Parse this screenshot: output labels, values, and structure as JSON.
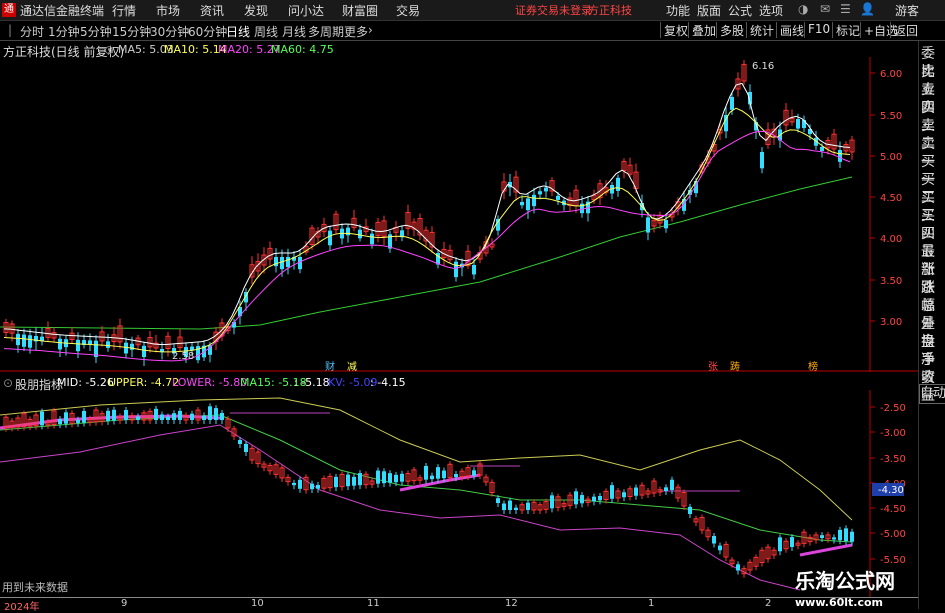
{
  "app": {
    "title": "通达信金融终端",
    "menus": [
      "行情",
      "市场",
      "资讯",
      "发现",
      "问小达",
      "财富圈",
      "交易"
    ],
    "notice": "证券交易未登录",
    "stock_name_top": "方正科技",
    "right_menus": [
      "功能",
      "版面",
      "公式",
      "选项"
    ],
    "guest": "游客"
  },
  "toolbar": {
    "periods": [
      "分时",
      "1分钟",
      "5分钟",
      "15分钟",
      "30分钟",
      "60分钟",
      "日线",
      "周线",
      "月线",
      "多周期",
      "更多"
    ],
    "active_period": "日线",
    "right_buttons": [
      "复权",
      "叠加",
      "多股",
      "统计",
      "画线",
      "F10",
      "标记",
      "+自选",
      "返回"
    ]
  },
  "main_chart": {
    "title": "方正科技(日线 前复权)",
    "ma_labels": [
      {
        "text": "MA5: 5.03",
        "color": "#ffffff"
      },
      {
        "text": "MA10: 5.14",
        "color": "#ffff55"
      },
      {
        "text": "MA20: 5.27",
        "color": "#ff44ff"
      },
      {
        "text": "MA60: 4.75",
        "color": "#55ff55"
      }
    ],
    "price_ticks": [
      "6.00",
      "5.50",
      "5.00",
      "4.50",
      "4.00",
      "3.50",
      "3.00"
    ],
    "high_label": "6.16",
    "low_label": "2.58",
    "markers": [
      "财",
      "减",
      "张",
      "踌",
      "榜"
    ]
  },
  "indicator": {
    "name": "股朋指标",
    "labels": [
      {
        "text": "MID: -5.26",
        "color": "#ffffff"
      },
      {
        "text": "UPPER: -4.72",
        "color": "#ffff55"
      },
      {
        "text": "LOWER: -5.80",
        "color": "#ff44ff"
      },
      {
        "text": "MA15: -5.18",
        "color": "#55ff55"
      },
      {
        "text": ": -5.18",
        "color": "#ffffff"
      },
      {
        "text": "KV: -5.09",
        "color": "#4444ff"
      },
      {
        "text": ": -4.15",
        "color": "#ffffff"
      }
    ],
    "ticks": [
      "-2.50",
      "-3.00",
      "-3.50",
      "-4.00",
      "-4.50",
      "-5.00",
      "-5.50"
    ],
    "current_value": "-4.30",
    "footnote": "用到未来数据"
  },
  "date_axis": [
    "2024年",
    "9",
    "10",
    "11",
    "12",
    "1",
    "2"
  ],
  "side_panel": [
    "委比",
    "卖五",
    "卖四",
    "卖三",
    "卖二",
    "卖一",
    "买一",
    "买二",
    "买三",
    "买四",
    "买五",
    "最新",
    "涨跌",
    "涨幅",
    "总量",
    "外盘",
    "换手",
    "净资",
    "收益"
  ],
  "side_auto": "自动",
  "watermark": {
    "line1": "乐淘公式网",
    "line2": "www.60lt.com"
  }
}
